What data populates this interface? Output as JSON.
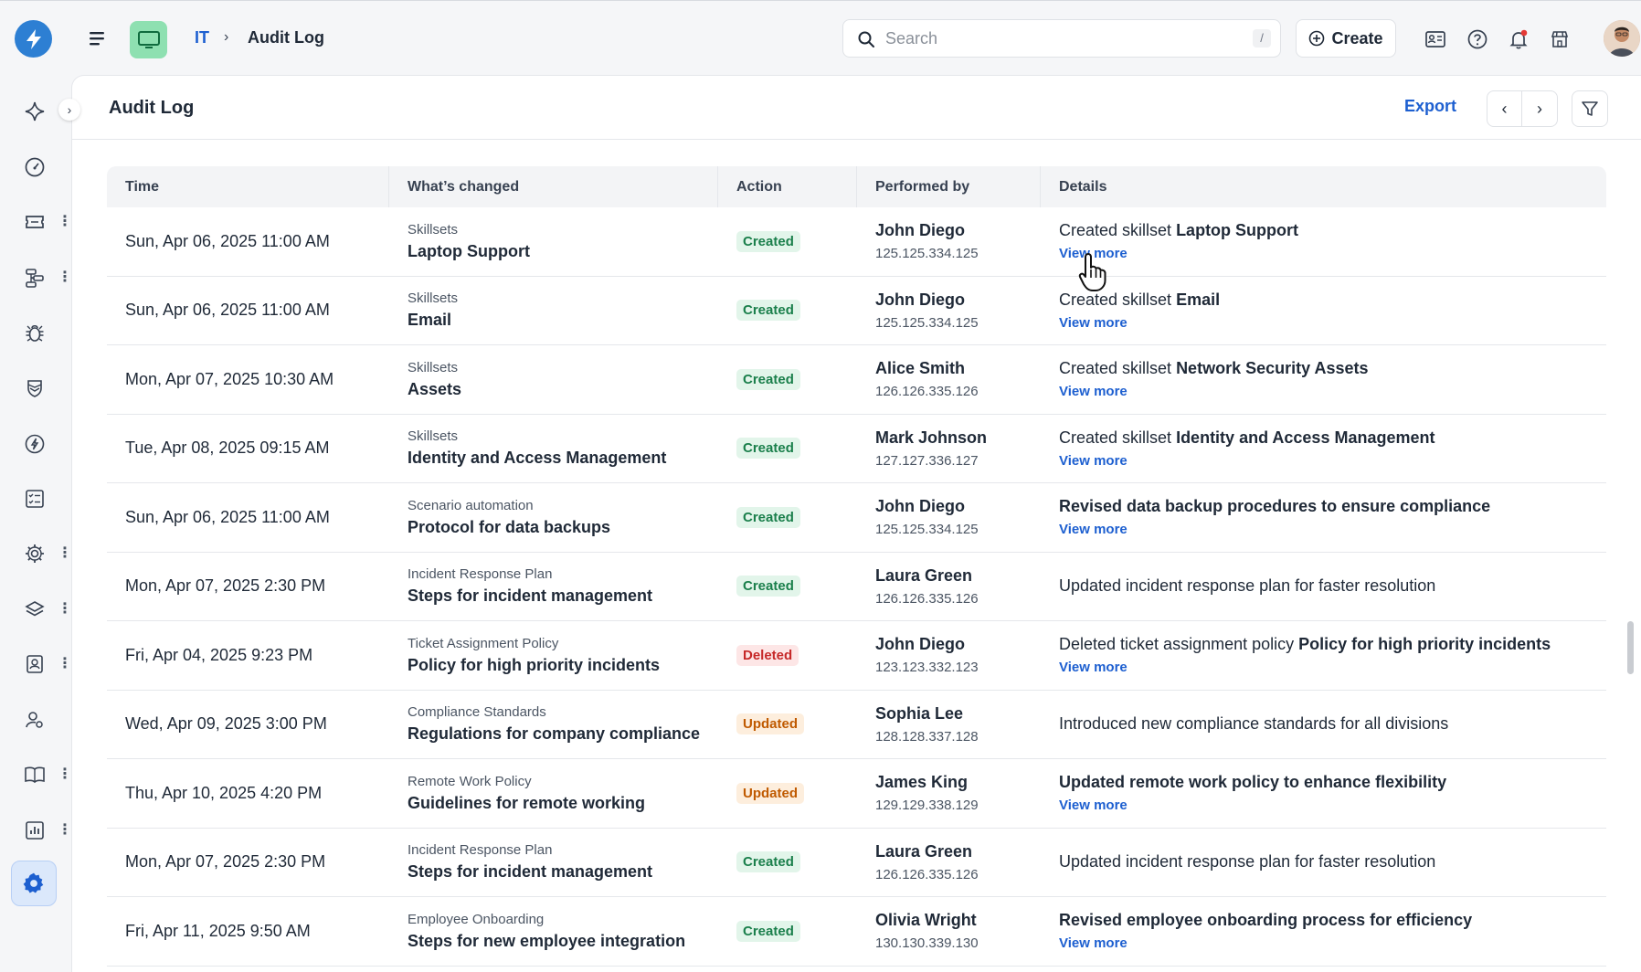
{
  "topbar": {
    "breadcrumb": {
      "root": "IT",
      "separator": "›",
      "current": "Audit Log"
    },
    "search": {
      "placeholder": "Search",
      "shortcut": "/"
    },
    "create_label": "Create",
    "icons": [
      "app-logo-icon",
      "hamburger-menu-icon",
      "workspace-monitor-icon",
      "id-card-icon",
      "help-icon",
      "notification-bell-icon",
      "marketplace-store-icon",
      "user-avatar"
    ]
  },
  "sidebar": {
    "items": [
      "sparkle-icon",
      "dashboard-gauge-icon",
      "tickets-icon",
      "workflow-icon",
      "bug-icon",
      "shield-icon",
      "compass-icon",
      "checklist-icon",
      "automation-gear-icon",
      "layers-icon",
      "contact-book-icon",
      "user-settings-icon",
      "knowledge-book-icon",
      "reports-chart-icon",
      "settings-icon"
    ],
    "active": "settings-icon",
    "accent_color": "#1d5fd0"
  },
  "panel": {
    "title": "Audit Log",
    "export_label": "Export",
    "prev_label": "‹",
    "next_label": "›"
  },
  "table": {
    "headers": [
      "Time",
      "What’s changed",
      "Action",
      "Performed by",
      "Details"
    ],
    "rows": [
      {
        "time": "Sun, Apr 06, 2025 11:00 AM",
        "category": "Skillsets",
        "item": "Laptop Support",
        "action": "Created",
        "user": "John Diego",
        "ip": "125.125.334.125",
        "details_prefix": "Created skillset ",
        "details_bold": "Laptop Support",
        "view_more": "View more"
      },
      {
        "time": "Sun, Apr 06, 2025 11:00 AM",
        "category": "Skillsets",
        "item": "Email",
        "action": "Created",
        "user": "John Diego",
        "ip": "125.125.334.125",
        "details_prefix": "Created skillset ",
        "details_bold": "Email",
        "view_more": "View more"
      },
      {
        "time": "Mon, Apr 07, 2025 10:30 AM",
        "category": "Skillsets",
        "item": "Assets",
        "action": "Created",
        "user": "Alice Smith",
        "ip": "126.126.335.126",
        "details_prefix": "Created skillset ",
        "details_bold": "Network Security Assets",
        "view_more": "View more"
      },
      {
        "time": "Tue, Apr 08, 2025 09:15 AM",
        "category": "Skillsets",
        "item": "Identity and Access Management",
        "action": "Created",
        "user": "Mark Johnson",
        "ip": "127.127.336.127",
        "details_prefix": "Created skillset ",
        "details_bold": "Identity and Access Management",
        "view_more": "View more"
      },
      {
        "time": "Sun, Apr 06, 2025 11:00 AM",
        "category": "Scenario automation",
        "item": "Protocol for data backups",
        "action": "Created",
        "user": "John Diego",
        "ip": "125.125.334.125",
        "details_prefix": "",
        "details_bold": "Revised data backup procedures to ensure compliance",
        "view_more": "View more"
      },
      {
        "time": "Mon, Apr 07, 2025 2:30 PM",
        "category": "Incident Response Plan",
        "item": "Steps for incident management",
        "action": "Created",
        "user": "Laura Green",
        "ip": "126.126.335.126",
        "details_prefix": "Updated incident response plan for faster resolution",
        "details_bold": "",
        "view_more": ""
      },
      {
        "time": "Fri, Apr 04, 2025 9:23 PM",
        "category": "Ticket Assignment Policy",
        "item": "Policy for high priority incidents",
        "action": "Deleted",
        "user": "John Diego",
        "ip": "123.123.332.123",
        "details_prefix": "Deleted ticket assignment policy ",
        "details_bold": "Policy for high priority incidents",
        "view_more": "View more"
      },
      {
        "time": "Wed, Apr 09, 2025 3:00 PM",
        "category": "Compliance Standards",
        "item": "Regulations for company compliance",
        "action": "Updated",
        "user": "Sophia Lee",
        "ip": "128.128.337.128",
        "details_prefix": "Introduced new compliance standards for all divisions",
        "details_bold": "",
        "view_more": ""
      },
      {
        "time": "Thu, Apr 10, 2025 4:20 PM",
        "category": "Remote Work Policy",
        "item": "Guidelines for remote working",
        "action": "Updated",
        "user": "James King",
        "ip": "129.129.338.129",
        "details_prefix": "",
        "details_bold": "Updated remote work policy to enhance flexibility",
        "view_more": "View more"
      },
      {
        "time": "Mon, Apr 07, 2025 2:30 PM",
        "category": "Incident Response Plan",
        "item": "Steps for incident management",
        "action": "Created",
        "user": "Laura Green",
        "ip": "126.126.335.126",
        "details_prefix": "Updated incident response plan for faster resolution",
        "details_bold": "",
        "view_more": ""
      },
      {
        "time": "Fri, Apr 11, 2025 9:50 AM",
        "category": "Employee Onboarding",
        "item": "Steps for new employee integration",
        "action": "Created",
        "user": "Olivia Wright",
        "ip": "130.130.339.130",
        "details_prefix": "",
        "details_bold": "Revised employee onboarding process for efficiency",
        "view_more": "View more"
      }
    ]
  },
  "colors": {
    "created_bg": "#e2f5ea",
    "created_fg": "#1a7f4b",
    "deleted_bg": "#fde6e6",
    "deleted_fg": "#c62828",
    "updated_bg": "#fdeedd",
    "updated_fg": "#c05a00",
    "link": "#1d5fd0"
  }
}
